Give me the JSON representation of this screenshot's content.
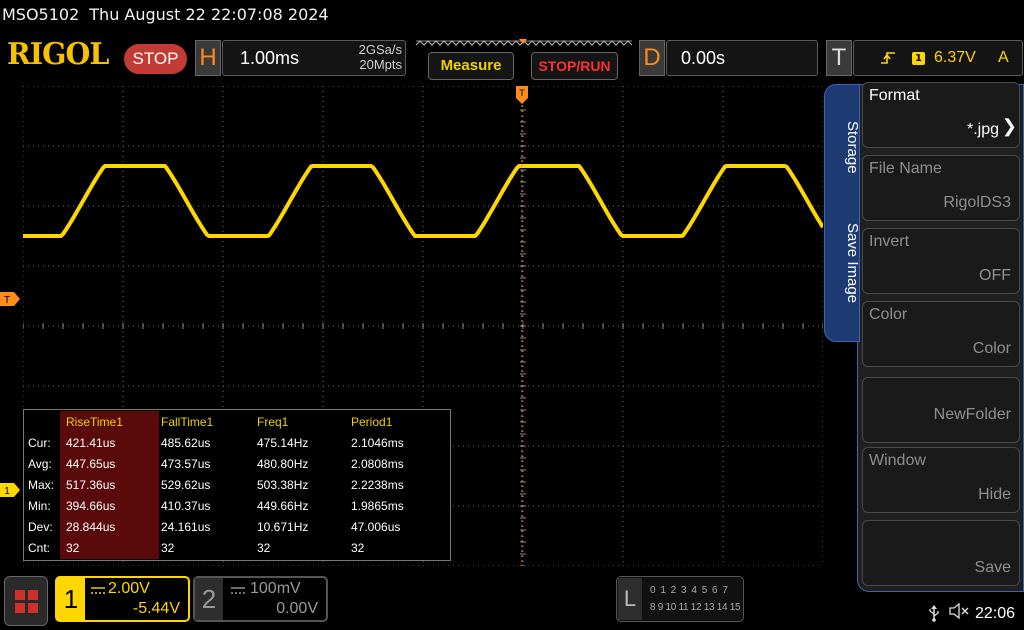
{
  "header": {
    "model": "MSO5102",
    "datetime": "Thu August 22 22:07:08 2024",
    "brand": "RIGOL",
    "run_state": "STOP"
  },
  "horizontal": {
    "letter": "H",
    "timebase": "1.00ms",
    "sample_rate": "2GSa/s",
    "memory_depth": "20Mpts"
  },
  "buttons": {
    "measure": "Measure",
    "stop_run": "STOP/RUN"
  },
  "delay": {
    "letter": "D",
    "value": "0.00s"
  },
  "trigger": {
    "letter": "T",
    "source": "1",
    "level": "6.37V",
    "mode": "A",
    "marker": "T"
  },
  "side_menu": {
    "tab_storage": "Storage",
    "tab_save_image": "Save Image",
    "items": [
      {
        "label": "Format",
        "value": "*.jpg"
      },
      {
        "label": "File Name",
        "value": "RigolDS3"
      },
      {
        "label": "Invert",
        "value": "OFF"
      },
      {
        "label": "Color",
        "value": "Color"
      },
      {
        "label": "",
        "value": "NewFolder"
      },
      {
        "label": "Window",
        "value": "Hide"
      },
      {
        "label": "",
        "value": "Save"
      }
    ]
  },
  "measurements": {
    "headers": [
      "RiseTime1",
      "FallTime1",
      "Freq1",
      "Period1"
    ],
    "rows": [
      {
        "label": "Cur:",
        "values": [
          "421.41us",
          "485.62us",
          "475.14Hz",
          "2.1046ms"
        ]
      },
      {
        "label": "Avg:",
        "values": [
          "447.65us",
          "473.57us",
          "480.80Hz",
          "2.0808ms"
        ]
      },
      {
        "label": "Max:",
        "values": [
          "517.36us",
          "529.62us",
          "503.38Hz",
          "2.2238ms"
        ]
      },
      {
        "label": "Min:",
        "values": [
          "394.66us",
          "410.37us",
          "449.66Hz",
          "1.9865ms"
        ]
      },
      {
        "label": "Dev:",
        "values": [
          "28.844us",
          "24.161us",
          "10.671Hz",
          "47.006us"
        ]
      },
      {
        "label": "Cnt:",
        "values": [
          "32",
          "32",
          "32",
          "32"
        ]
      }
    ]
  },
  "channels": {
    "ch1": {
      "number": "1",
      "scale": "2.00V",
      "offset": "-5.44V",
      "color": "#ffd700",
      "marker": "1"
    },
    "ch2": {
      "number": "2",
      "scale": "100mV",
      "offset": "0.00V",
      "color": "#9a9a9a"
    }
  },
  "logic": {
    "letter": "L",
    "row1": "0 1 2 3  4 5 6 7",
    "row2": "8 9 10 11 12 13 14 15"
  },
  "status": {
    "time": "22:06",
    "usb_icon": "usb-icon",
    "sound_icon": "sound-muted-icon"
  },
  "colors": {
    "trace": "#ffd700",
    "accent_orange": "#ff8c1a",
    "menu_blue": "#1d3a73"
  }
}
